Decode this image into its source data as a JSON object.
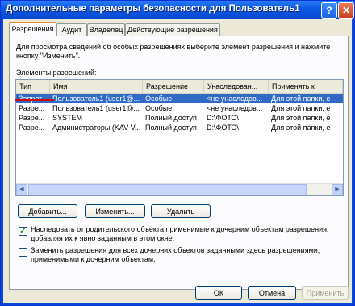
{
  "window": {
    "title": "Дополнительные параметры безопасности для Пользователь1",
    "help_glyph": "?",
    "close_glyph": "✕"
  },
  "tabs": [
    {
      "label": "Разрешения"
    },
    {
      "label": "Аудит"
    },
    {
      "label": "Владелец"
    },
    {
      "label": "Действующие разрешения"
    }
  ],
  "description": "Для просмотра сведений об особых разрешениях выберите элемент разрешения и нажмите кнопку \"Изменить\".",
  "elements_label": "Элементы разрешений:",
  "columns": [
    "Тип",
    "Имя",
    "Разрешение",
    "Унаследован...",
    "Применять к"
  ],
  "rows": [
    [
      "Запрет...",
      "Пользователь1 (user1@...",
      "Особые",
      "<не унаследов...",
      "Для этой папки, е"
    ],
    [
      "Разре...",
      "Пользователь1 (user1@...",
      "Особые",
      "<не унаследов...",
      "Для этой папки, е"
    ],
    [
      "Разре...",
      "SYSTEM",
      "Полный доступ",
      "D:\\ФОТО\\",
      "Для этой папки, е"
    ],
    [
      "Разре...",
      "Администраторы (KAV-V...",
      "Полный доступ",
      "D:\\ФОТО\\",
      "Для этой папки, е"
    ]
  ],
  "selected_row": 0,
  "scroll": {
    "left_glyph": "◀",
    "right_glyph": "▶"
  },
  "buttons": {
    "add": "Добавить...",
    "edit": "Изменить...",
    "remove": "Удалить"
  },
  "checkboxes": [
    {
      "checked": true,
      "mark": "✓",
      "text": "Наследовать от родительского объекта применимые к дочерним объектам разрешения, добавляя их к явно заданным в этом окне."
    },
    {
      "checked": false,
      "mark": "",
      "text": "Заменить разрешения для всех дочерних объектов заданными здесь разрешениями, применимыми к дочерним объектам."
    }
  ],
  "footer": {
    "ok": "ОК",
    "cancel": "Отмена",
    "apply": "Применить"
  }
}
